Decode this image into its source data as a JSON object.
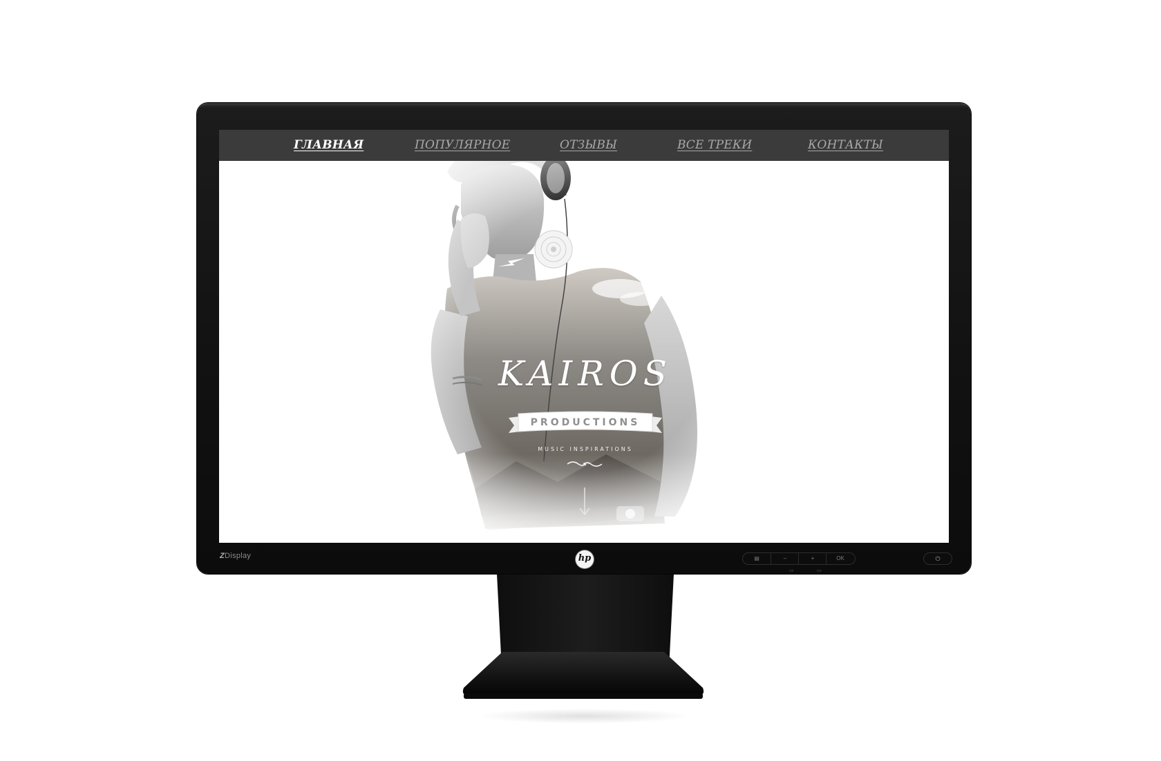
{
  "nav": {
    "items": [
      {
        "label": "ГЛАВНАЯ",
        "active": true
      },
      {
        "label": "ПОПУЛЯРНОЕ",
        "active": false
      },
      {
        "label": "ОТЗЫВЫ",
        "active": false
      },
      {
        "label": "ВСЕ ТРЕКИ",
        "active": false
      },
      {
        "label": "КОНТАКТЫ",
        "active": false
      }
    ]
  },
  "hero": {
    "logo_title": "KAIROS",
    "ribbon_text": "PRODUCTIONS",
    "tagline": "MUSIC INSPIRATIONS",
    "icons": [
      "vinyl-disc-icon",
      "lightning-bolt-icon",
      "flourish-ornament-icon",
      "arrow-down-icon"
    ]
  },
  "monitor": {
    "model_label_prefix": "Z",
    "model_label": "Display",
    "brand_logo_text": "hp",
    "osd_buttons": [
      "▤",
      "–",
      "+",
      "OK"
    ],
    "osd_sub_icons": [
      "▭",
      "▭"
    ],
    "power_icon": "⏻"
  },
  "colors": {
    "navbar_bg": "#3b3b3b",
    "nav_text": "#a9a9a9",
    "nav_active": "#ffffff",
    "bezel": "#111111",
    "screen_bg": "#ffffff"
  }
}
